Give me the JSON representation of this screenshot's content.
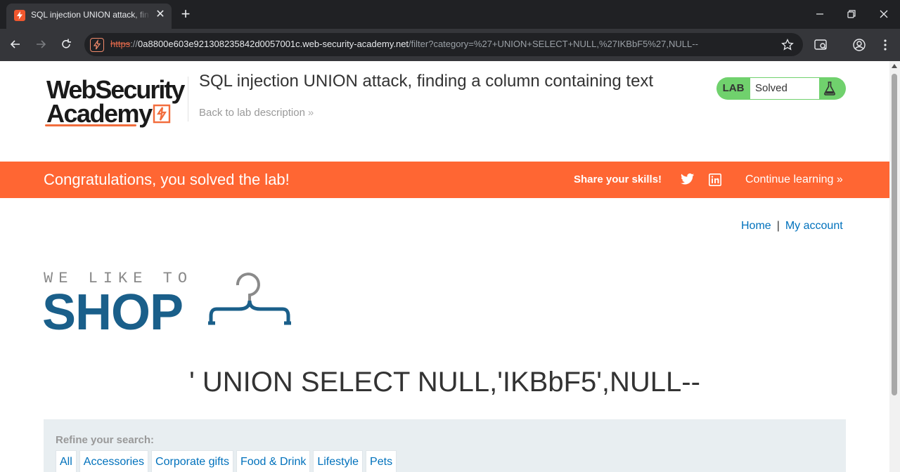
{
  "browser": {
    "tab_title": "SQL injection UNION attack, finding a column containing text",
    "tab_close": "✕",
    "new_tab": "+",
    "url_scheme": "https",
    "url_host_prefix": "://",
    "url_host": "0a8800e603e921308235842d0057001c.web-security-academy.net",
    "url_path": "/filter?category=%27+UNION+SELECT+NULL,%27IKBbF5%27,NULL--"
  },
  "header": {
    "logo_line1": "WebSecurity",
    "logo_line2": "Academy",
    "lab_title": "SQL injection UNION attack, finding a column containing text",
    "back_link": "Back to lab description",
    "back_chevron": "»",
    "lab_badge_label": "LAB",
    "lab_status": "Solved"
  },
  "banner": {
    "message": "Congratulations, you solved the lab!",
    "share_label": "Share your skills!",
    "continue_label": "Continue learning",
    "continue_chevron": "»"
  },
  "nav": {
    "home": "Home",
    "separator": "|",
    "my_account": "My account"
  },
  "shop_logo": {
    "tagline": "WE LIKE TO",
    "word": "SHOP"
  },
  "main": {
    "query_heading": "' UNION SELECT NULL,'IKBbF5',NULL--",
    "refine_label": "Refine your search:",
    "filters": [
      "All",
      "Accessories",
      "Corporate gifts",
      "Food & Drink",
      "Lifestyle",
      "Pets"
    ]
  },
  "colors": {
    "banner": "#ff6633",
    "link": "#0071bc",
    "lab_solved": "#70d16d",
    "shop_blue": "#1a5f8a"
  }
}
